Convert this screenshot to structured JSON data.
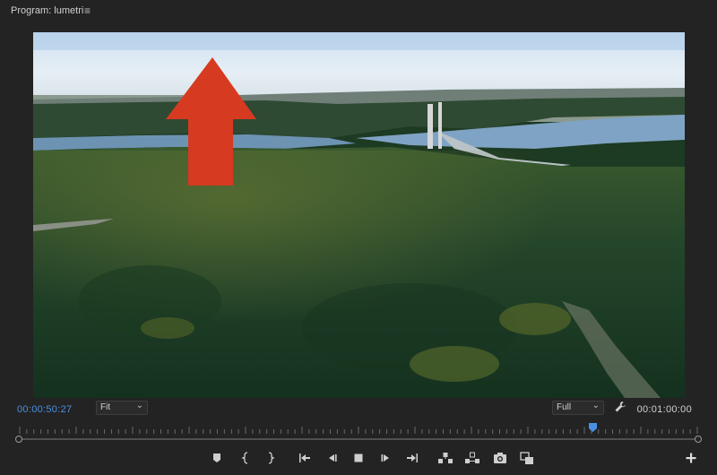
{
  "panel": {
    "title": "Program: lumetri",
    "menu_icon": "hamburger-menu-icon"
  },
  "video": {
    "annotation": "red-up-arrow",
    "arrow_color": "#d63a20"
  },
  "timecode": {
    "current": "00:00:50:27",
    "duration": "00:01:00:00",
    "current_color": "#4a90e2"
  },
  "controls": {
    "zoom_level": "Fit",
    "resolution": "Full",
    "settings_icon": "wrench-icon",
    "playhead_position": 0.846,
    "playhead_color": "#4a90e2"
  },
  "transport": {
    "buttons": [
      "add-marker-icon",
      "mark-in-icon",
      "mark-out-icon",
      "go-to-in-icon",
      "step-back-icon",
      "stop-icon",
      "step-forward-icon",
      "go-to-out-icon",
      "lift-icon",
      "extract-icon",
      "export-frame-icon",
      "comparison-view-icon"
    ],
    "add_button": "plus-icon"
  }
}
